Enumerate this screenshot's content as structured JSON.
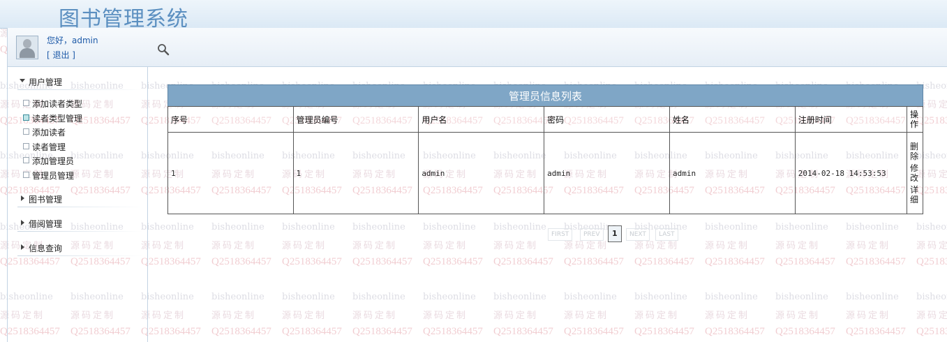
{
  "app": {
    "title": "图书管理系统"
  },
  "watermark": {
    "line1": "bisheonline",
    "line2": "源码定制",
    "line3": "Q2518364457"
  },
  "user": {
    "greeting": "您好，admin",
    "logout": "[ 退出 ]"
  },
  "toolbar": {
    "search_icon": "search-icon"
  },
  "sidebar": {
    "menus": [
      {
        "label": "用户管理",
        "expanded": true,
        "items": [
          "添加读者类型",
          "读者类型管理",
          "添加读者",
          "读者管理",
          "添加管理员",
          "管理员管理"
        ],
        "active_index": 1
      },
      {
        "label": "图书管理",
        "expanded": false
      },
      {
        "label": "借阅管理",
        "expanded": false
      },
      {
        "label": "信息查询",
        "expanded": false
      }
    ]
  },
  "table": {
    "caption": "管理员信息列表",
    "headers": [
      "序号",
      "管理员编号",
      "用户名",
      "密码",
      "姓名",
      "注册时间",
      "操作"
    ],
    "rows": [
      {
        "cells": [
          "1",
          "1",
          "admin",
          "admin",
          "admin",
          "2014-02-18 14:53:53"
        ],
        "actions": [
          "删除",
          "修改",
          "详细"
        ]
      }
    ]
  },
  "pager": {
    "first": "FIRST",
    "prev": "PREV",
    "current": "1",
    "next": "NEXT",
    "last": "LAST"
  },
  "colors": {
    "caption_bg": "#7fa6c6",
    "title": "#5b8fc0",
    "link": "#1e5aa8"
  }
}
